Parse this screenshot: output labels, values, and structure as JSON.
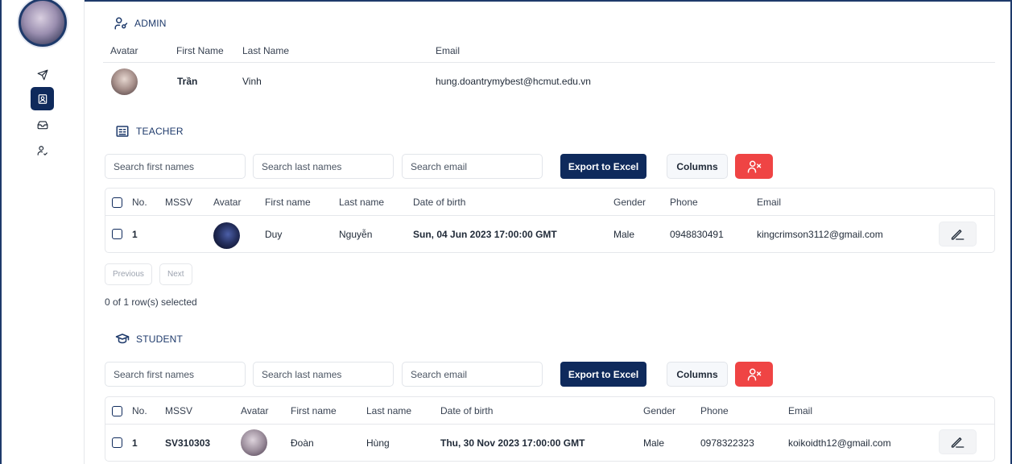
{
  "sidebar": {
    "icons": [
      "send-icon",
      "contact-card-icon",
      "inbox-icon",
      "user-check-icon"
    ]
  },
  "admin": {
    "title": "ADMIN",
    "columns": {
      "avatar": "Avatar",
      "first_name": "First Name",
      "last_name": "Last Name",
      "email": "Email"
    },
    "row": {
      "first_name": "Trần",
      "last_name": "Vinh",
      "email": "hung.doantrymybest@hcmut.edu.vn"
    }
  },
  "teacher": {
    "title": "TEACHER",
    "search": {
      "first": "Search first names",
      "last": "Search last names",
      "email": "Search email"
    },
    "export_label": "Export to Excel",
    "columns_label": "Columns",
    "columns": {
      "no": "No.",
      "mssv": "MSSV",
      "avatar": "Avatar",
      "first_name": "First name",
      "last_name": "Last name",
      "dob": "Date of birth",
      "gender": "Gender",
      "phone": "Phone",
      "email": "Email"
    },
    "rows": [
      {
        "no": "1",
        "mssv": "",
        "first_name": "Duy",
        "last_name": "Nguyễn",
        "dob": "Sun, 04 Jun 2023 17:00:00 GMT",
        "gender": "Male",
        "phone": "0948830491",
        "email": "kingcrimson3112@gmail.com"
      }
    ],
    "pager": {
      "previous": "Previous",
      "next": "Next"
    },
    "selected_text": "0 of 1 row(s) selected"
  },
  "student": {
    "title": "STUDENT",
    "search": {
      "first": "Search first names",
      "last": "Search last names",
      "email": "Search email"
    },
    "export_label": "Export to Excel",
    "columns_label": "Columns",
    "columns": {
      "no": "No.",
      "mssv": "MSSV",
      "avatar": "Avatar",
      "first_name": "First name",
      "last_name": "Last name",
      "dob": "Date of birth",
      "gender": "Gender",
      "phone": "Phone",
      "email": "Email"
    },
    "rows": [
      {
        "no": "1",
        "mssv": "SV310303",
        "first_name": "Đoàn",
        "last_name": "Hùng",
        "dob": "Thu, 30 Nov 2023 17:00:00 GMT",
        "gender": "Male",
        "phone": "0978322323",
        "email": "koikoidth12@gmail.com"
      }
    ]
  },
  "colors": {
    "primary": "#0f2a5c",
    "danger": "#ef4444",
    "border": "#e5e7eb"
  }
}
